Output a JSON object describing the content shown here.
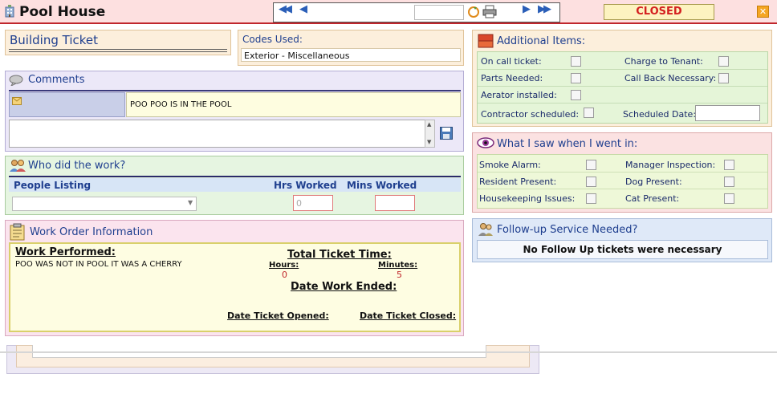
{
  "window": {
    "title": "Pool House",
    "status": "CLOSED",
    "close_glyph": "✕"
  },
  "icons": {
    "title": "building-icon",
    "first": "double-left-arrow-icon",
    "prev": "left-arrow-icon",
    "refresh": "refresh-icon",
    "print": "printer-icon",
    "next": "right-arrow-icon",
    "last": "double-right-arrow-icon"
  },
  "building_ticket": {
    "title": "Building Ticket"
  },
  "codes": {
    "title": "Codes Used:",
    "value": "Exterior - Miscellaneous"
  },
  "comments": {
    "title": "Comments",
    "entry_text": "POO POO IS IN THE POOL",
    "new_comment_value": ""
  },
  "who": {
    "title": "Who did the work?",
    "col_people": "People Listing",
    "col_hrs": "Hrs Worked",
    "col_mins": "Mins Worked",
    "person_value": "",
    "hrs_value": "0",
    "mins_value": ""
  },
  "work_order": {
    "title": "Work Order Information",
    "work_performed_label": "Work Performed:",
    "work_performed_text": "POO WAS NOT IN POOL IT WAS A CHERRY",
    "total_time_label": "Total Ticket Time:",
    "hours_label": "Hours:",
    "hours_value": "0",
    "minutes_label": "Minutes:",
    "minutes_value": "5",
    "date_ended_label": "Date Work Ended:",
    "date_opened_label": "Date Ticket Opened:",
    "date_closed_label": "Date Ticket Closed:"
  },
  "additional": {
    "title": "Additional Items:",
    "on_call": "On call ticket:",
    "charge_tenant": "Charge to Tenant:",
    "parts_needed": "Parts Needed:",
    "call_back": "Call Back Necessary:",
    "aerator": "Aerator installed:",
    "contractor": "Contractor scheduled:",
    "scheduled_date": "Scheduled Date:",
    "scheduled_date_value": ""
  },
  "saw": {
    "title": "What I saw when I went in:",
    "smoke": "Smoke Alarm:",
    "manager": "Manager Inspection:",
    "resident": "Resident Present:",
    "dog": "Dog Present:",
    "housekeeping": "Housekeeping Issues:",
    "cat": "Cat Present:"
  },
  "followup": {
    "title": "Follow-up Service Needed?",
    "message": "No Follow Up tickets were necessary"
  }
}
